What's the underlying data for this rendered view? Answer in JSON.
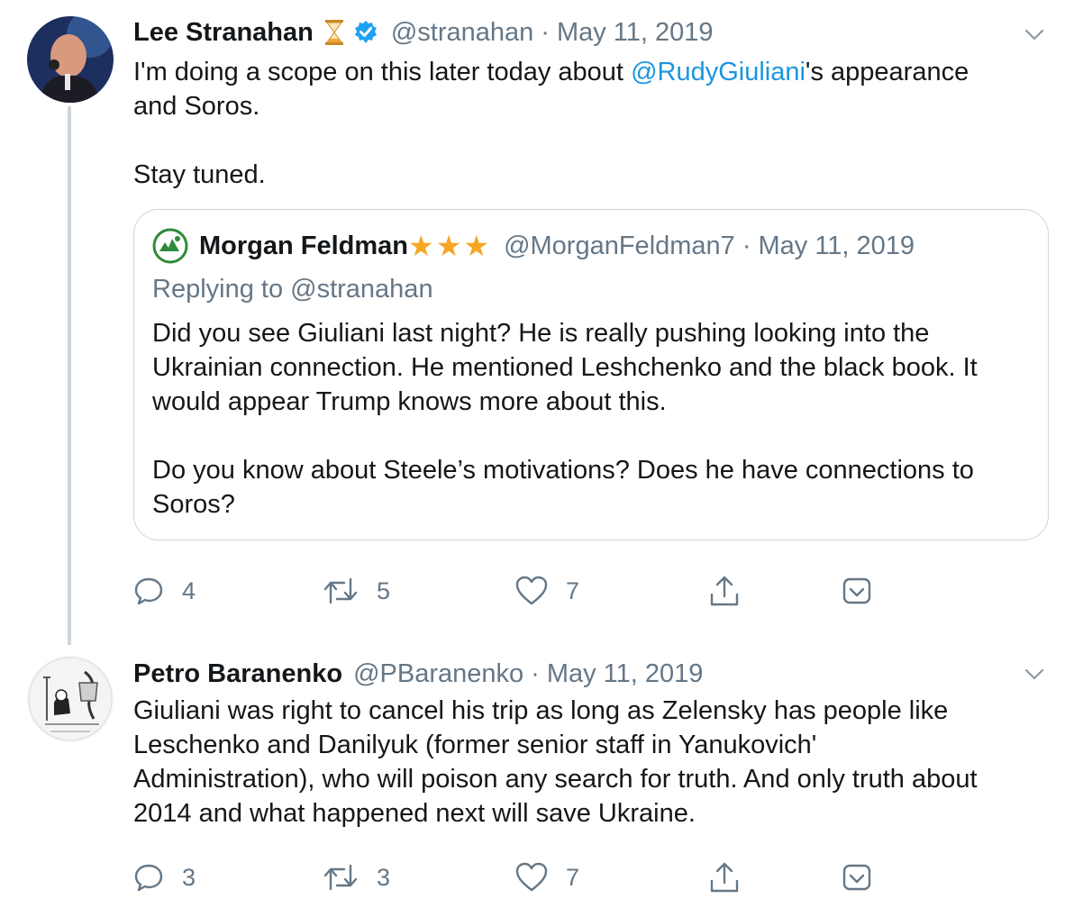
{
  "tweets": [
    {
      "name": "Lee Stranahan",
      "badge_icon": "hourglass-icon",
      "verified_icon": "verified-badge-icon",
      "handle": "@stranahan",
      "separator": "·",
      "date": "May 11, 2019",
      "text_before_mention": "I'm doing a scope on this later today about ",
      "mention": "@RudyGiuliani",
      "text_after_mention": "'s appearance\nand Soros.\n\nStay tuned.",
      "quote": {
        "name": "Morgan Feldman",
        "stars": "★★★",
        "handle": "@MorganFeldman7",
        "separator": "·",
        "date": "May 11, 2019",
        "replying_to": "Replying to @stranahan",
        "text": "Did you see Giuliani last night? He is really pushing looking into the\nUkrainian connection. He mentioned Leshchenko and the black book. It\nwould appear Trump knows more about this.\n\nDo you know about Steele’s motivations? Does he have connections to\nSoros?"
      },
      "actions": {
        "replies": "4",
        "retweets": "5",
        "likes": "7"
      }
    },
    {
      "name": "Petro Baranenko",
      "handle": "@PBaranenko",
      "separator": "·",
      "date": "May 11, 2019",
      "text": "Giuliani was right to cancel his trip as long as Zelensky has people like\nLeschenko and Danilyuk (former senior staff in Yanukovich'\nAdministration), who will poison any search for truth. And only truth about\n2014 and what happened next will save Ukraine.",
      "actions": {
        "replies": "3",
        "retweets": "3",
        "likes": "7"
      }
    }
  ],
  "colors": {
    "link": "#1b95e0",
    "muted": "#657786",
    "border": "#ccd6dd",
    "star": "#f5a623",
    "verified": "#1da1f2"
  }
}
